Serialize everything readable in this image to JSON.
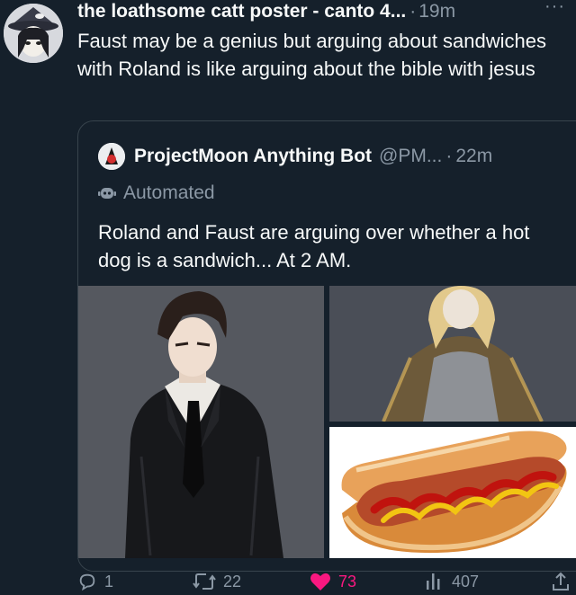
{
  "tweet": {
    "author_name": "the loathsome catt poster - canto 4...",
    "time_sep": "·",
    "time": "19m",
    "more": "···",
    "text": "Faust may be a genius but arguing about sandwiches with Roland is like arguing about the bible with jesus"
  },
  "quote": {
    "name": "ProjectMoon Anything Bot",
    "handle": "@PM...",
    "time_sep": "·",
    "time": "22m",
    "automated_label": "Automated",
    "text": "Roland and Faust are arguing over whether a hot dog is a sandwich... At 2 AM.",
    "media": [
      {
        "icon": "man-in-suit-illustration"
      },
      {
        "icon": "blonde-character-illustration"
      },
      {
        "icon": "hot-dog-photo"
      }
    ]
  },
  "actions": {
    "reply_count": "1",
    "retweet_count": "22",
    "like_count": "73",
    "views_count": "407"
  },
  "colors": {
    "background": "#15202b",
    "text_primary": "#f7f9f9",
    "text_secondary": "#8b98a5",
    "like": "#f91880",
    "border": "#38444d"
  }
}
